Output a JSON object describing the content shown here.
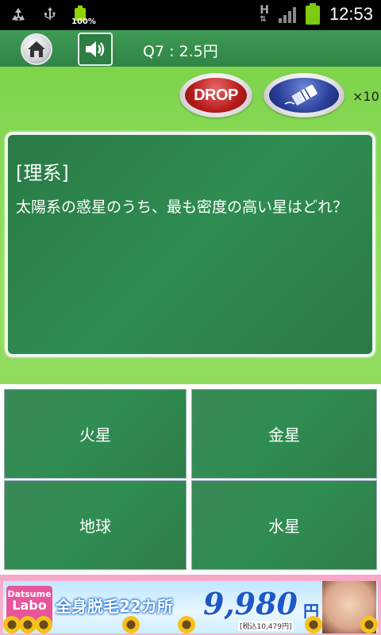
{
  "status_bar": {
    "battery_small_percent": "100%",
    "network_letter": "H",
    "time": "12:53",
    "icons": [
      "recycle-icon",
      "usb-icon",
      "battery-icon",
      "signal-icon",
      "battery-icon"
    ]
  },
  "top_bar": {
    "question_label": "Q7 : 2.5円",
    "icons": [
      "home-icon",
      "speaker-icon"
    ]
  },
  "tools": {
    "drop_label": "DROP",
    "eraser_count": "×10",
    "icons": [
      "eraser-icon"
    ]
  },
  "question": {
    "category": "[理系]",
    "text": "太陽系の惑星のうち、最も密度の高い星はどれ？"
  },
  "answers": [
    "火星",
    "金星",
    "地球",
    "水星"
  ],
  "ad": {
    "logo_line1": "Datsume",
    "logo_line2": "Labo",
    "copy": "全身脱毛22カ所",
    "price": "9,980",
    "yen": "円",
    "tax": "[税込10,479円]"
  },
  "colors": {
    "board_green": "#8fdb5c",
    "panel_green": "#2f8d52",
    "drop_red": "#b71b1b",
    "eraser_blue": "#2a3f99",
    "ad_pink": "#f4b7d0"
  }
}
